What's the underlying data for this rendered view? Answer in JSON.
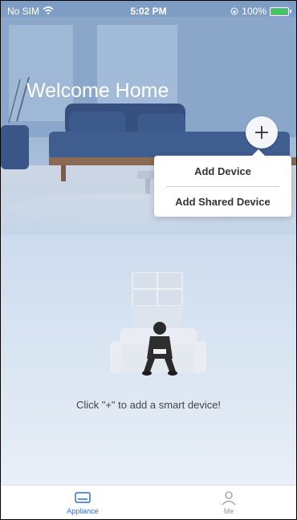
{
  "status_bar": {
    "carrier": "No SIM",
    "time": "5:02 PM",
    "battery": "100%"
  },
  "hero": {
    "title": "Welcome Home"
  },
  "add_menu": {
    "items": [
      "Add Device",
      "Add Shared Device"
    ]
  },
  "empty_state": {
    "hint": "Click \"+\" to add a smart device!"
  },
  "tabs": [
    {
      "label": "Appliance",
      "active": true,
      "icon": "appliance-icon"
    },
    {
      "label": "Me",
      "active": false,
      "icon": "person-icon"
    }
  ],
  "colors": {
    "accent": "#2f6ed3",
    "battery": "#3ec75d"
  }
}
